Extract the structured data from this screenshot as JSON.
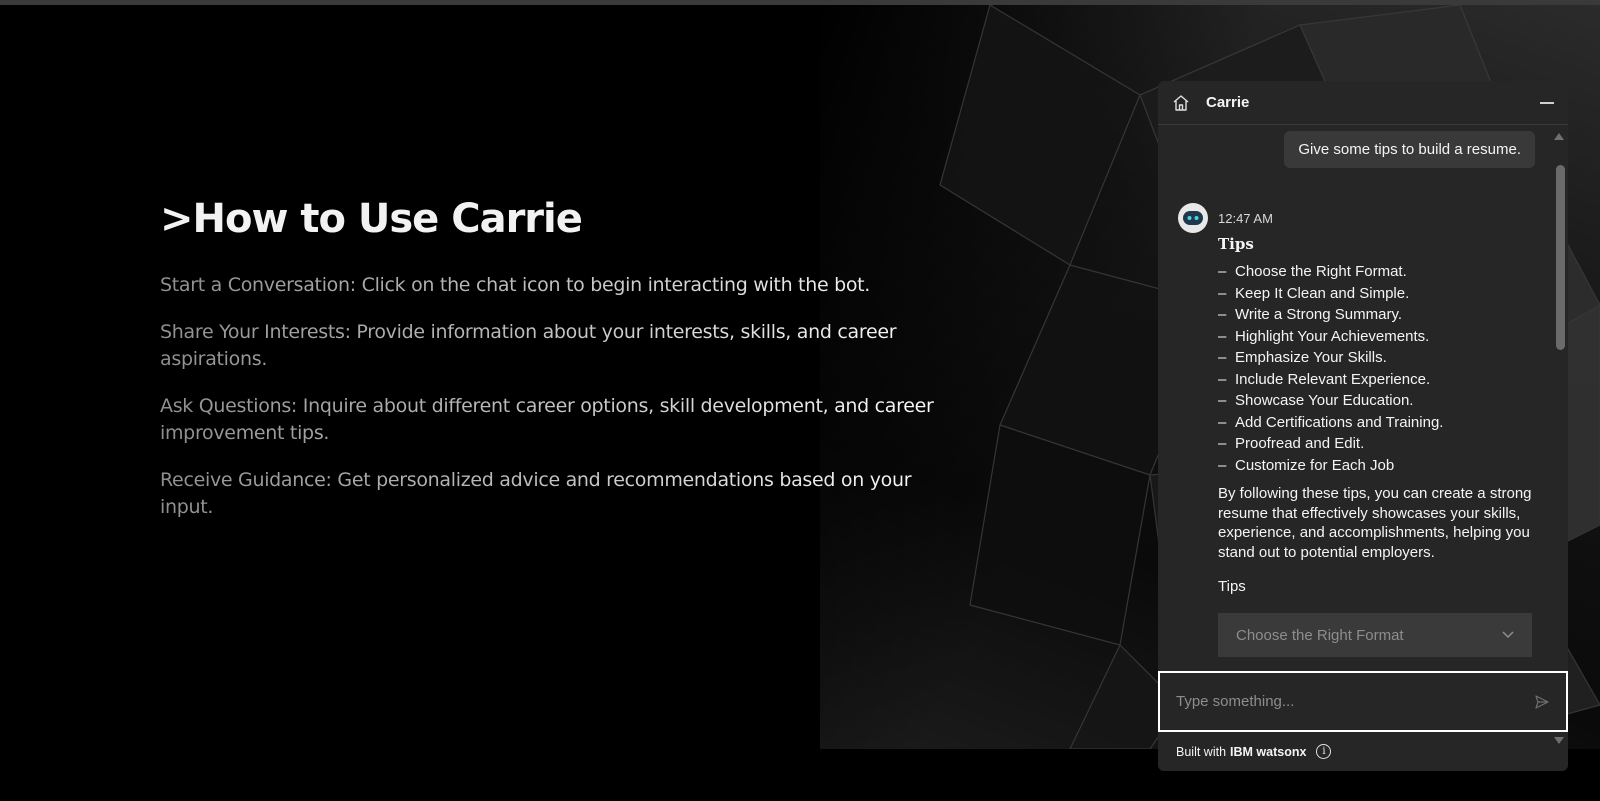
{
  "hero": {
    "title": ">How to Use Carrie",
    "items": [
      {
        "label": "Start a Conversation:",
        "text": " Click on the chat icon to begin interacting with the bot."
      },
      {
        "label": "Share Your Interests:",
        "text": " Provide information about your interests, skills, and career aspirations."
      },
      {
        "label": "Ask Questions:",
        "text": " Inquire about different career options, skill development, and career improvement tips."
      },
      {
        "label": "Receive Guidance:",
        "text": " Get personalized advice and recommendations based on your input."
      }
    ]
  },
  "chat": {
    "title": "Carrie",
    "user_message": "Give some tips to build a resume.",
    "bot_time": "12:47 AM",
    "tips_title": "Tips",
    "tips": [
      "Choose the Right Format.",
      "Keep It Clean and Simple.",
      "Write a Strong Summary.",
      "Highlight Your Achievements.",
      "Emphasize Your Skills.",
      "Include Relevant Experience.",
      "Showcase Your Education.",
      "Add Certifications and Training.",
      "Proofread and Edit.",
      "Customize for Each Job"
    ],
    "summary": "By following these tips, you can create a strong resume that effectively showcases your skills, experience, and accomplishments, helping you stand out to potential employers.",
    "tips_label": "Tips",
    "dropdown_value": "Choose the Right Format",
    "input_placeholder": "Type something...",
    "footer_prefix": "Built with",
    "footer_brand": "IBM watsonx",
    "info_glyph": "i"
  },
  "icons": {
    "home": "home-icon",
    "minimize": "minimize-icon",
    "send": "send-icon",
    "info": "info-icon",
    "chevron": "chevron-down-icon",
    "bot": "bot-avatar-icon"
  }
}
